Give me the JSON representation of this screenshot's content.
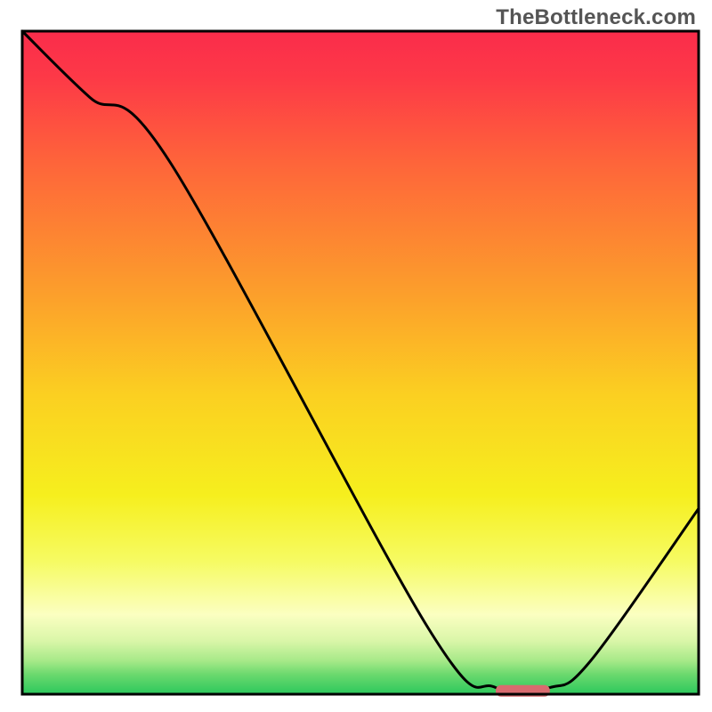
{
  "watermark": "TheBottleneck.com",
  "chart_data": {
    "type": "line",
    "title": "",
    "xlabel": "",
    "ylabel": "",
    "ylim": [
      0,
      100
    ],
    "xlim": [
      0,
      100
    ],
    "x": [
      0,
      10,
      22,
      60,
      70,
      78,
      84,
      100
    ],
    "values": [
      100,
      90,
      80,
      10,
      1,
      1,
      5,
      28
    ],
    "annotations": [
      {
        "type": "marker",
        "x_range": [
          70,
          78
        ],
        "color": "#d96b6f"
      }
    ],
    "background": {
      "type": "vertical-gradient",
      "stops": [
        {
          "pos": 0.0,
          "color": "#fa2c4b"
        },
        {
          "pos": 0.07,
          "color": "#fd3947"
        },
        {
          "pos": 0.2,
          "color": "#fe653a"
        },
        {
          "pos": 0.4,
          "color": "#fca02b"
        },
        {
          "pos": 0.55,
          "color": "#fbd021"
        },
        {
          "pos": 0.7,
          "color": "#f6ef1e"
        },
        {
          "pos": 0.8,
          "color": "#f6fb63"
        },
        {
          "pos": 0.88,
          "color": "#fbffc1"
        },
        {
          "pos": 0.92,
          "color": "#d9f6a8"
        },
        {
          "pos": 0.95,
          "color": "#a6e988"
        },
        {
          "pos": 0.97,
          "color": "#6bd96e"
        },
        {
          "pos": 1.0,
          "color": "#2cc85c"
        }
      ]
    },
    "frame": {
      "stroke": "#000000",
      "width": 3
    },
    "curve": {
      "stroke": "#000000",
      "width": 3
    },
    "marker": {
      "fill": "#d96b6f",
      "rx": 6,
      "height": 13,
      "y_value": 0.5
    }
  }
}
